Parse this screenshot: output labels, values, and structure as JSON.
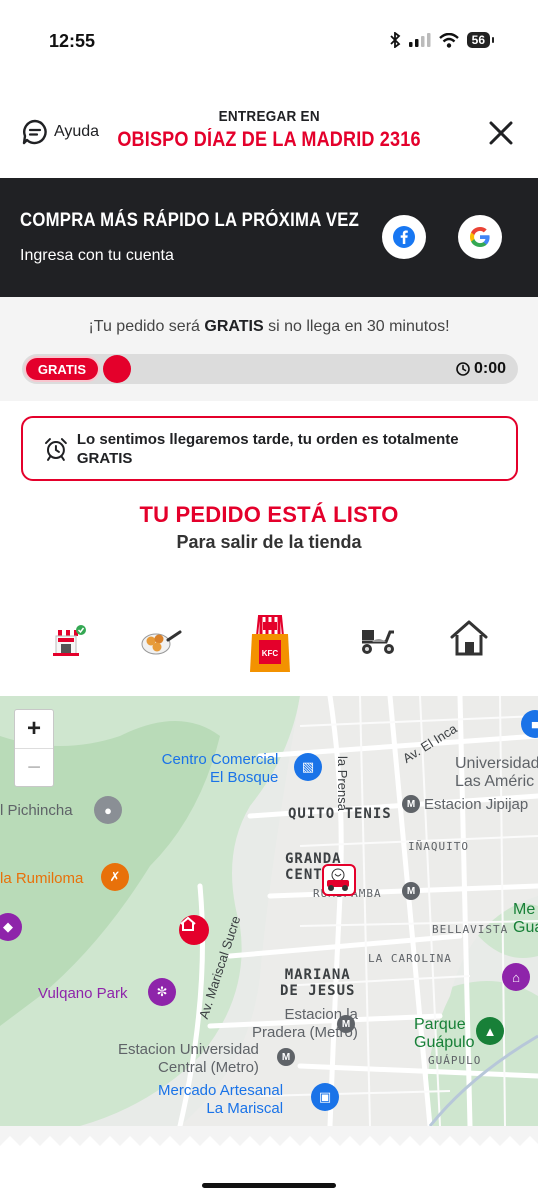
{
  "status_bar": {
    "time": "12:55",
    "battery": "56",
    "icons": [
      "bluetooth-icon",
      "signal-icon",
      "wifi-icon",
      "battery-icon"
    ]
  },
  "header": {
    "help_label": "Ayuda",
    "deliver_label": "ENTREGAR EN",
    "deliver_address": "OBISPO DÍAZ DE LA MADRID 2316"
  },
  "login_banner": {
    "title": "COMPRA MÁS RÁPIDO LA PRÓXIMA VEZ",
    "subtitle": "Ingresa con tu cuenta"
  },
  "promo": {
    "text_before": "¡Tu pedido será ",
    "text_bold": "GRATIS",
    "text_after": " si no llega en 30 minutos!",
    "badge": "GRATIS",
    "timer": "0:00",
    "progress": 0
  },
  "late_notice": {
    "text": "Lo sentimos llegaremos tarde, tu orden es totalmente GRATIS"
  },
  "order_status": {
    "title": "TU PEDIDO ESTÁ LISTO",
    "subtitle": "Para salir de la tienda"
  },
  "steps": [
    {
      "icon": "store-confirmed-icon"
    },
    {
      "icon": "cooking-icon"
    },
    {
      "icon": "bag-ready-icon",
      "active": true
    },
    {
      "icon": "delivery-scooter-icon"
    },
    {
      "icon": "home-icon"
    }
  ],
  "map": {
    "zoom_in": "+",
    "zoom_out": "−",
    "labels": {
      "cc_bosque_1": "Centro Comercial",
      "cc_bosque_2": "El Bosque",
      "pichincha": "l Pichincha",
      "rumiloma": "la Rumiloma",
      "vulqano": "Vulqano Park",
      "quito_tenis": "QUITO TENIS",
      "granda_1": "GRANDA",
      "granda_2": "CENTE",
      "rumipamba": "RUMIPAMBA",
      "inaquito": "IÑAQUITO",
      "bellavista": "BELLAVISTA",
      "carolina": "LA CAROLINA",
      "mariana_1": "MARIANA",
      "mariana_2": "DE JESUS",
      "guapulo": "GUÁPULO",
      "udla_1": "Universidad",
      "udla_2": "Las Améric",
      "jipijapa": "Estacion Jipijap",
      "pradera_1": "Estacion la",
      "pradera_2": "Pradera (Metro)",
      "ucentral_1": "Estacion Universidad",
      "ucentral_2": "Central (Metro)",
      "mercado_1": "Mercado Artesanal",
      "mercado_2": "La Mariscal",
      "parque_1": "Parque",
      "parque_2": "Guápulo",
      "me_1": "Me",
      "me_2": "Gua",
      "av_inca": "Av. El Inca",
      "la_prensa": "la Prensa",
      "mariscal_sucre": "Av. Mariscal Sucre",
      "kfc": "KFC"
    }
  },
  "colors": {
    "brand_red": "#e4002b",
    "dark": "#202124",
    "promo_bg": "#f4f4f4"
  }
}
